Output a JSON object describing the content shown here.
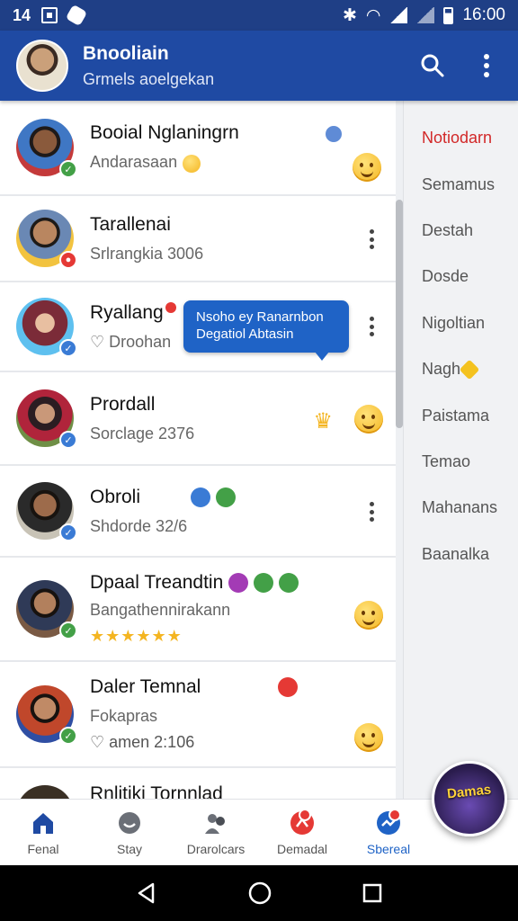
{
  "status": {
    "time_left": "14",
    "time_right": "16:00"
  },
  "header": {
    "title": "Bnooliain",
    "subtitle": "Grmels aoelgekan"
  },
  "colors": {
    "header_blue": "#1f4aa3",
    "accent_red": "#d22828",
    "tooltip_blue": "#1f63c6",
    "online_green": "#43a047"
  },
  "chats": [
    {
      "name": "Booial Nglaningrn",
      "sub": "Andarasaan",
      "badge": "green"
    },
    {
      "name": "Tarallenai",
      "sub": "Srlrangkia 3006",
      "badge": "red"
    },
    {
      "name": "Ryallang",
      "sub": "Droohan",
      "badge": "blue"
    },
    {
      "name": "Prordall",
      "sub": "Sorclage 2376",
      "badge": "blue"
    },
    {
      "name": "Obroli",
      "sub": "Shdorde 32/6",
      "badge": "blue"
    },
    {
      "name": "Dpaal Treandtin",
      "sub": "Bangathennirakann",
      "badge": "green"
    },
    {
      "name": "Daler Temnal",
      "sub": "Fokapras",
      "sub2": "amen 2:106",
      "badge": "green"
    },
    {
      "name": "Rnlitiki Tornnlad",
      "sub": "",
      "badge": "none"
    }
  ],
  "tooltip": {
    "line1": "Nsoho ey Ranarnbon",
    "line2": "Degatiol Abtasin"
  },
  "side_panel": {
    "items": [
      {
        "label": "Notiodarn",
        "active": true
      },
      {
        "label": "Semamus",
        "active": false
      },
      {
        "label": "Destah",
        "active": false
      },
      {
        "label": "Dosde",
        "active": false
      },
      {
        "label": "Nigoltian",
        "active": false
      },
      {
        "label": "Nagh",
        "active": false
      },
      {
        "label": "Paistama",
        "active": false
      },
      {
        "label": "Temao",
        "active": false
      },
      {
        "label": "Mahanans",
        "active": false
      },
      {
        "label": "Baanalka",
        "active": false
      }
    ]
  },
  "fab": {
    "label": "Damas"
  },
  "bottom_nav": [
    {
      "label": "Fenal",
      "icon": "home-icon",
      "active": false
    },
    {
      "label": "Stay",
      "icon": "story-icon",
      "active": false
    },
    {
      "label": "Drarolcars",
      "icon": "people-icon",
      "active": false
    },
    {
      "label": "Demadal",
      "icon": "chat-icon",
      "active": false
    },
    {
      "label": "Sbereal",
      "icon": "messenger-icon",
      "active": true
    }
  ]
}
